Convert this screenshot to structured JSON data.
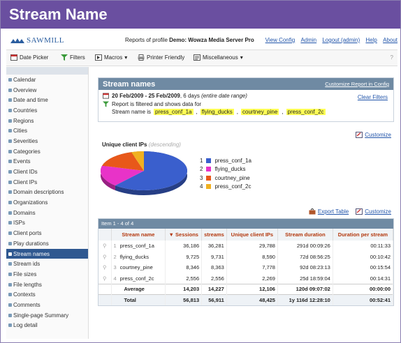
{
  "window_title": "Stream Name",
  "logo": "SAWMILL",
  "profile": {
    "prefix": "Reports of profile ",
    "name": "Demo: Wowza Media Server Pro"
  },
  "top_links": [
    "View Config",
    "Admin",
    "Logout (admin)",
    "Help",
    "About"
  ],
  "toolbar": {
    "date_picker": "Date Picker",
    "filters": "Filters",
    "macros": "Macros",
    "printer_friendly": "Printer Friendly",
    "miscellaneous": "Miscellaneous",
    "help_mark": "?"
  },
  "sidebar": {
    "items": [
      "Calendar",
      "Overview",
      "Date and time",
      "Countries",
      "Regions",
      "Cities",
      "Severities",
      "Categories",
      "Events",
      "Client IDs",
      "Client IPs",
      "Domain descriptions",
      "Organizations",
      "Domains",
      "ISPs",
      "Client ports",
      "Play durations",
      "Stream names",
      "Stream ids",
      "File sizes",
      "File lengths",
      "Contexts",
      "Comments",
      "Single-page Summary",
      "Log detail"
    ],
    "active_index": 17
  },
  "report": {
    "title": "Stream names",
    "customize_link": "Customize Report in Config",
    "date_range_bold": "20 Feb/2009 - 25 Feb/2009",
    "date_range_days": ", 6 days ",
    "date_range_note": "(entire date range)",
    "filter_note": "Report is filtered and shows data for",
    "stream_name_is": "Stream name is",
    "filter_values": [
      "press_conf_1a",
      "flying_ducks",
      "courtney_pine",
      "press_conf_2c"
    ],
    "clear_filters": "Clear Filters"
  },
  "chart_customize": "Customize",
  "chart_data": {
    "type": "pie",
    "title": "Unique client IPs",
    "subtitle": "(descending)",
    "categories": [
      "press_conf_1a",
      "flying_ducks",
      "courtney_pine",
      "press_conf_2c"
    ],
    "values": [
      29788,
      8590,
      7778,
      2269
    ],
    "colors": [
      "#3a5fcd",
      "#e833c8",
      "#e8581a",
      "#f0b020"
    ],
    "legend_numbers": [
      "1",
      "2",
      "3",
      "4"
    ]
  },
  "table": {
    "export_label": "Export Table",
    "customize_label": "Customize",
    "item_range": "Item 1 - 4 of 4",
    "columns": [
      "Stream name",
      "▼ Sessions",
      "streams",
      "Unique client IPs",
      "Stream duration",
      "Duration per stream"
    ],
    "rows": [
      {
        "n": "1",
        "name": "press_conf_1a",
        "sessions": "36,186",
        "streams": "36,281",
        "ips": "29,788",
        "duration": "291d 00:09:26",
        "per": "00:11:33"
      },
      {
        "n": "2",
        "name": "flying_ducks",
        "sessions": "9,725",
        "streams": "9,731",
        "ips": "8,590",
        "duration": "72d 08:56:25",
        "per": "00:10:42"
      },
      {
        "n": "3",
        "name": "courtney_pine",
        "sessions": "8,346",
        "streams": "8,363",
        "ips": "7,778",
        "duration": "92d 08:23:13",
        "per": "00:15:54"
      },
      {
        "n": "4",
        "name": "press_conf_2c",
        "sessions": "2,556",
        "streams": "2,556",
        "ips": "2,269",
        "duration": "25d 18:59:04",
        "per": "00:14:31"
      }
    ],
    "average": {
      "label": "Average",
      "sessions": "14,203",
      "streams": "14,227",
      "ips": "12,106",
      "duration": "120d 09:07:02",
      "per": "00:00:00"
    },
    "total": {
      "label": "Total",
      "sessions": "56,813",
      "streams": "56,911",
      "ips": "48,425",
      "duration": "1y 116d 12:28:10",
      "per": "00:52:41"
    }
  }
}
